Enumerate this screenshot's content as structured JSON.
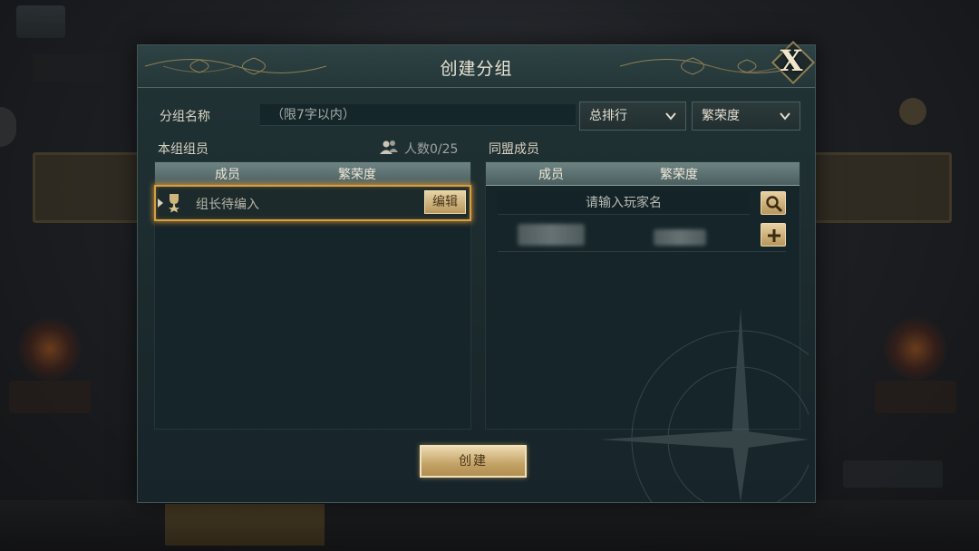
{
  "background": {
    "title": "",
    "tabs": []
  },
  "dialog": {
    "title": "创建分组",
    "close_label": "X",
    "group_name_label": "分组名称",
    "group_name_placeholder": "（限7字以内）",
    "sort_select": "总排行",
    "filter_select": "繁荣度",
    "own_members_label": "本组组员",
    "member_count": "人数0/25",
    "alliance_members_label": "同盟成员",
    "left_table": {
      "columns": [
        "成员",
        "繁荣度"
      ],
      "rows": [
        {
          "name": "组长待编入",
          "action": "编辑"
        }
      ]
    },
    "right_table": {
      "columns": [
        "成员",
        "繁荣度"
      ],
      "search_placeholder": "请输入玩家名"
    },
    "create_label": "创建"
  },
  "colors": {
    "accent_gold": "#d4a040",
    "panel_bg": "#15252a",
    "header_bg": "#2e4345"
  }
}
